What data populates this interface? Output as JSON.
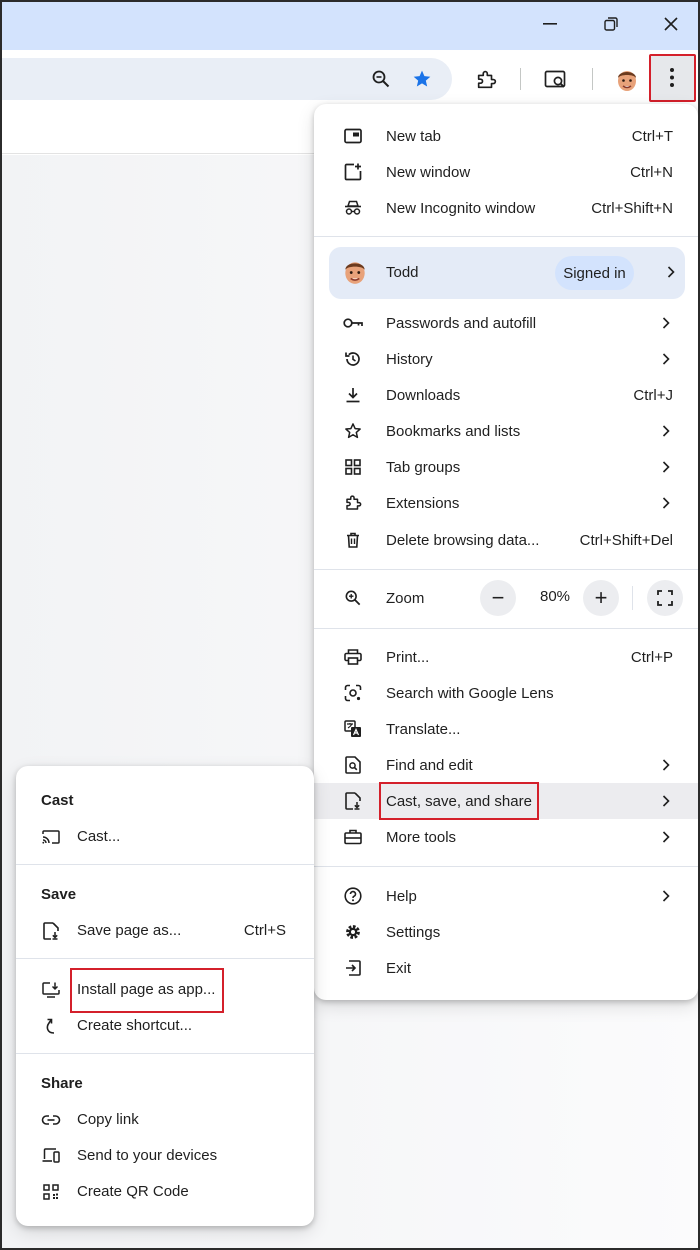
{
  "window": {
    "minimize_icon": "minimize-icon",
    "restore_icon": "restore-icon",
    "close_icon": "close-icon"
  },
  "toolbar": {
    "icons": [
      "zoom-icon",
      "bookmark-star-icon",
      "extensions-icon",
      "lens-search-icon",
      "profile-avatar",
      "kebab-menu-icon"
    ],
    "accent_color": "#1a73e8",
    "highlight_color": "#d4202b"
  },
  "menu": {
    "group1": [
      {
        "label": "New tab",
        "shortcut": "Ctrl+T",
        "icon": "new-tab-icon"
      },
      {
        "label": "New window",
        "shortcut": "Ctrl+N",
        "icon": "new-window-icon"
      },
      {
        "label": "New Incognito window",
        "shortcut": "Ctrl+Shift+N",
        "icon": "incognito-icon"
      }
    ],
    "profile": {
      "name": "Todd",
      "status": "Signed in"
    },
    "group2": [
      {
        "label": "Passwords and autofill",
        "icon": "key-icon",
        "submenu": true
      },
      {
        "label": "History",
        "icon": "history-icon",
        "submenu": true
      },
      {
        "label": "Downloads",
        "shortcut": "Ctrl+J",
        "icon": "download-icon"
      },
      {
        "label": "Bookmarks and lists",
        "icon": "star-icon",
        "submenu": true
      },
      {
        "label": "Tab groups",
        "icon": "tab-groups-icon",
        "submenu": true
      },
      {
        "label": "Extensions",
        "icon": "extensions-icon",
        "submenu": true
      },
      {
        "label": "Delete browsing data...",
        "shortcut": "Ctrl+Shift+Del",
        "icon": "trash-icon"
      }
    ],
    "zoom": {
      "label": "Zoom",
      "minus": "−",
      "value": "80%",
      "plus": "+"
    },
    "group3": [
      {
        "label": "Print...",
        "shortcut": "Ctrl+P",
        "icon": "print-icon"
      },
      {
        "label": "Search with Google Lens",
        "icon": "lens-icon"
      },
      {
        "label": "Translate...",
        "icon": "translate-icon"
      },
      {
        "label": "Find and edit",
        "icon": "find-icon",
        "submenu": true
      },
      {
        "label": "Cast, save, and share",
        "icon": "cast-save-share-icon",
        "submenu": true
      },
      {
        "label": "More tools",
        "icon": "toolbox-icon",
        "submenu": true
      }
    ],
    "group4": [
      {
        "label": "Help",
        "icon": "help-icon",
        "submenu": true
      },
      {
        "label": "Settings",
        "icon": "settings-gear-icon"
      },
      {
        "label": "Exit",
        "icon": "exit-icon"
      }
    ]
  },
  "submenu": {
    "cast_heading": "Cast",
    "cast_item": "Cast...",
    "save_heading": "Save",
    "save_item": {
      "label": "Save page as...",
      "shortcut": "Ctrl+S"
    },
    "install_item": "Install page as app...",
    "shortcut_item": "Create shortcut...",
    "share_heading": "Share",
    "share_items": [
      "Copy link",
      "Send to your devices",
      "Create QR Code"
    ]
  }
}
